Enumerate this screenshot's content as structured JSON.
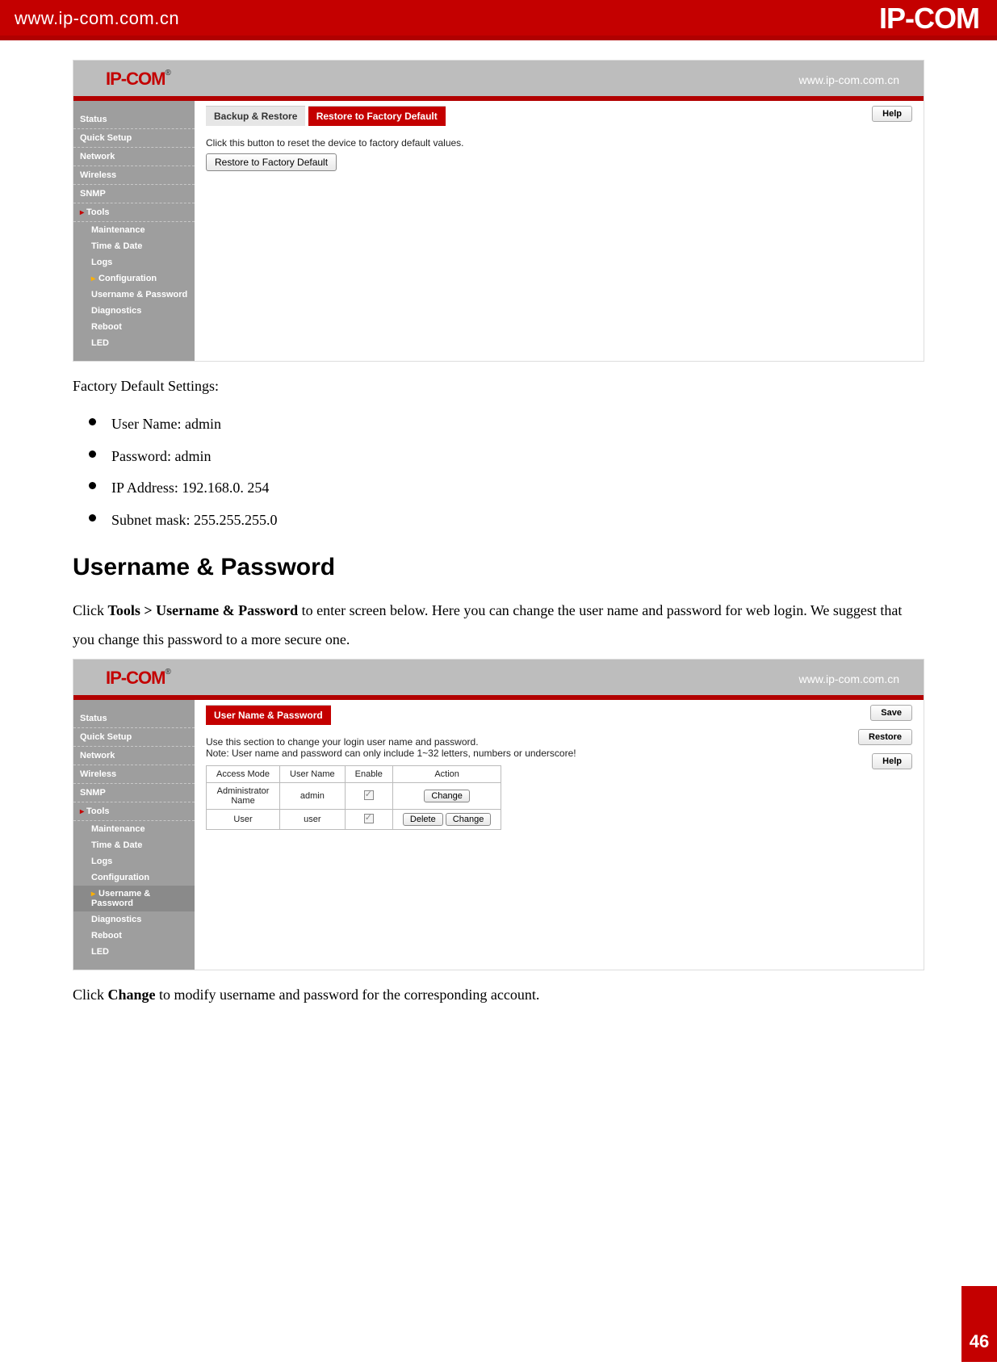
{
  "page_header": {
    "url": "www.ip-com.com.cn",
    "logo": "IP-COM"
  },
  "page_number": "46",
  "screenshot1": {
    "logo": "IP-COM",
    "tm": "®",
    "header_url": "www.ip-com.com.cn",
    "tabs": {
      "inactive": "Backup & Restore",
      "active": "Restore to Factory Default"
    },
    "instruction": "Click this button to reset the device to factory default values.",
    "restore_button": "Restore to Factory Default",
    "help_button": "Help",
    "sidebar": {
      "status": "Status",
      "quicksetup": "Quick Setup",
      "network": "Network",
      "wireless": "Wireless",
      "snmp": "SNMP",
      "tools": "Tools",
      "sub": {
        "maintenance": "Maintenance",
        "timedate": "Time & Date",
        "logs": "Logs",
        "configuration": "Configuration",
        "userpass": "Username & Password",
        "diagnostics": "Diagnostics",
        "reboot": "Reboot",
        "led": "LED"
      }
    }
  },
  "doc": {
    "intro": "Factory Default Settings:",
    "bullets": {
      "b1": "User Name: admin",
      "b2": "Password: admin",
      "b3": "IP Address: 192.168.0. 254",
      "b4": "Subnet mask: 255.255.255.0"
    },
    "heading": "Username & Password",
    "para1_pre": "Click ",
    "para1_nav": "Tools > Username & Password",
    "para1_post": " to enter screen below. Here you can change the user name and password for web login. We suggest that you change this password to a more secure one.",
    "para2_pre": "Click ",
    "para2_b": "Change",
    "para2_post": " to modify username and password for the corresponding account."
  },
  "screenshot2": {
    "logo": "IP-COM",
    "tm": "®",
    "header_url": "www.ip-com.com.cn",
    "tab_active": "User Name & Password",
    "line1": "Use this section to change your login user name and password.",
    "line2": "Note: User name and password can only include 1~32 letters, numbers or underscore!",
    "buttons": {
      "save": "Save",
      "restore": "Restore",
      "help": "Help"
    },
    "table": {
      "h1": "Access Mode",
      "h2": "User Name",
      "h3": "Enable",
      "h4": "Action",
      "r1c1a": "Administrator",
      "r1c1b": "Name",
      "r1c2": "admin",
      "r1_change": "Change",
      "r2c1": "User",
      "r2c2": "user",
      "r2_delete": "Delete",
      "r2_change": "Change"
    },
    "sidebar": {
      "status": "Status",
      "quicksetup": "Quick Setup",
      "network": "Network",
      "wireless": "Wireless",
      "snmp": "SNMP",
      "tools": "Tools",
      "sub": {
        "maintenance": "Maintenance",
        "timedate": "Time & Date",
        "logs": "Logs",
        "configuration": "Configuration",
        "userpass": "Username & Password",
        "diagnostics": "Diagnostics",
        "reboot": "Reboot",
        "led": "LED"
      }
    }
  }
}
